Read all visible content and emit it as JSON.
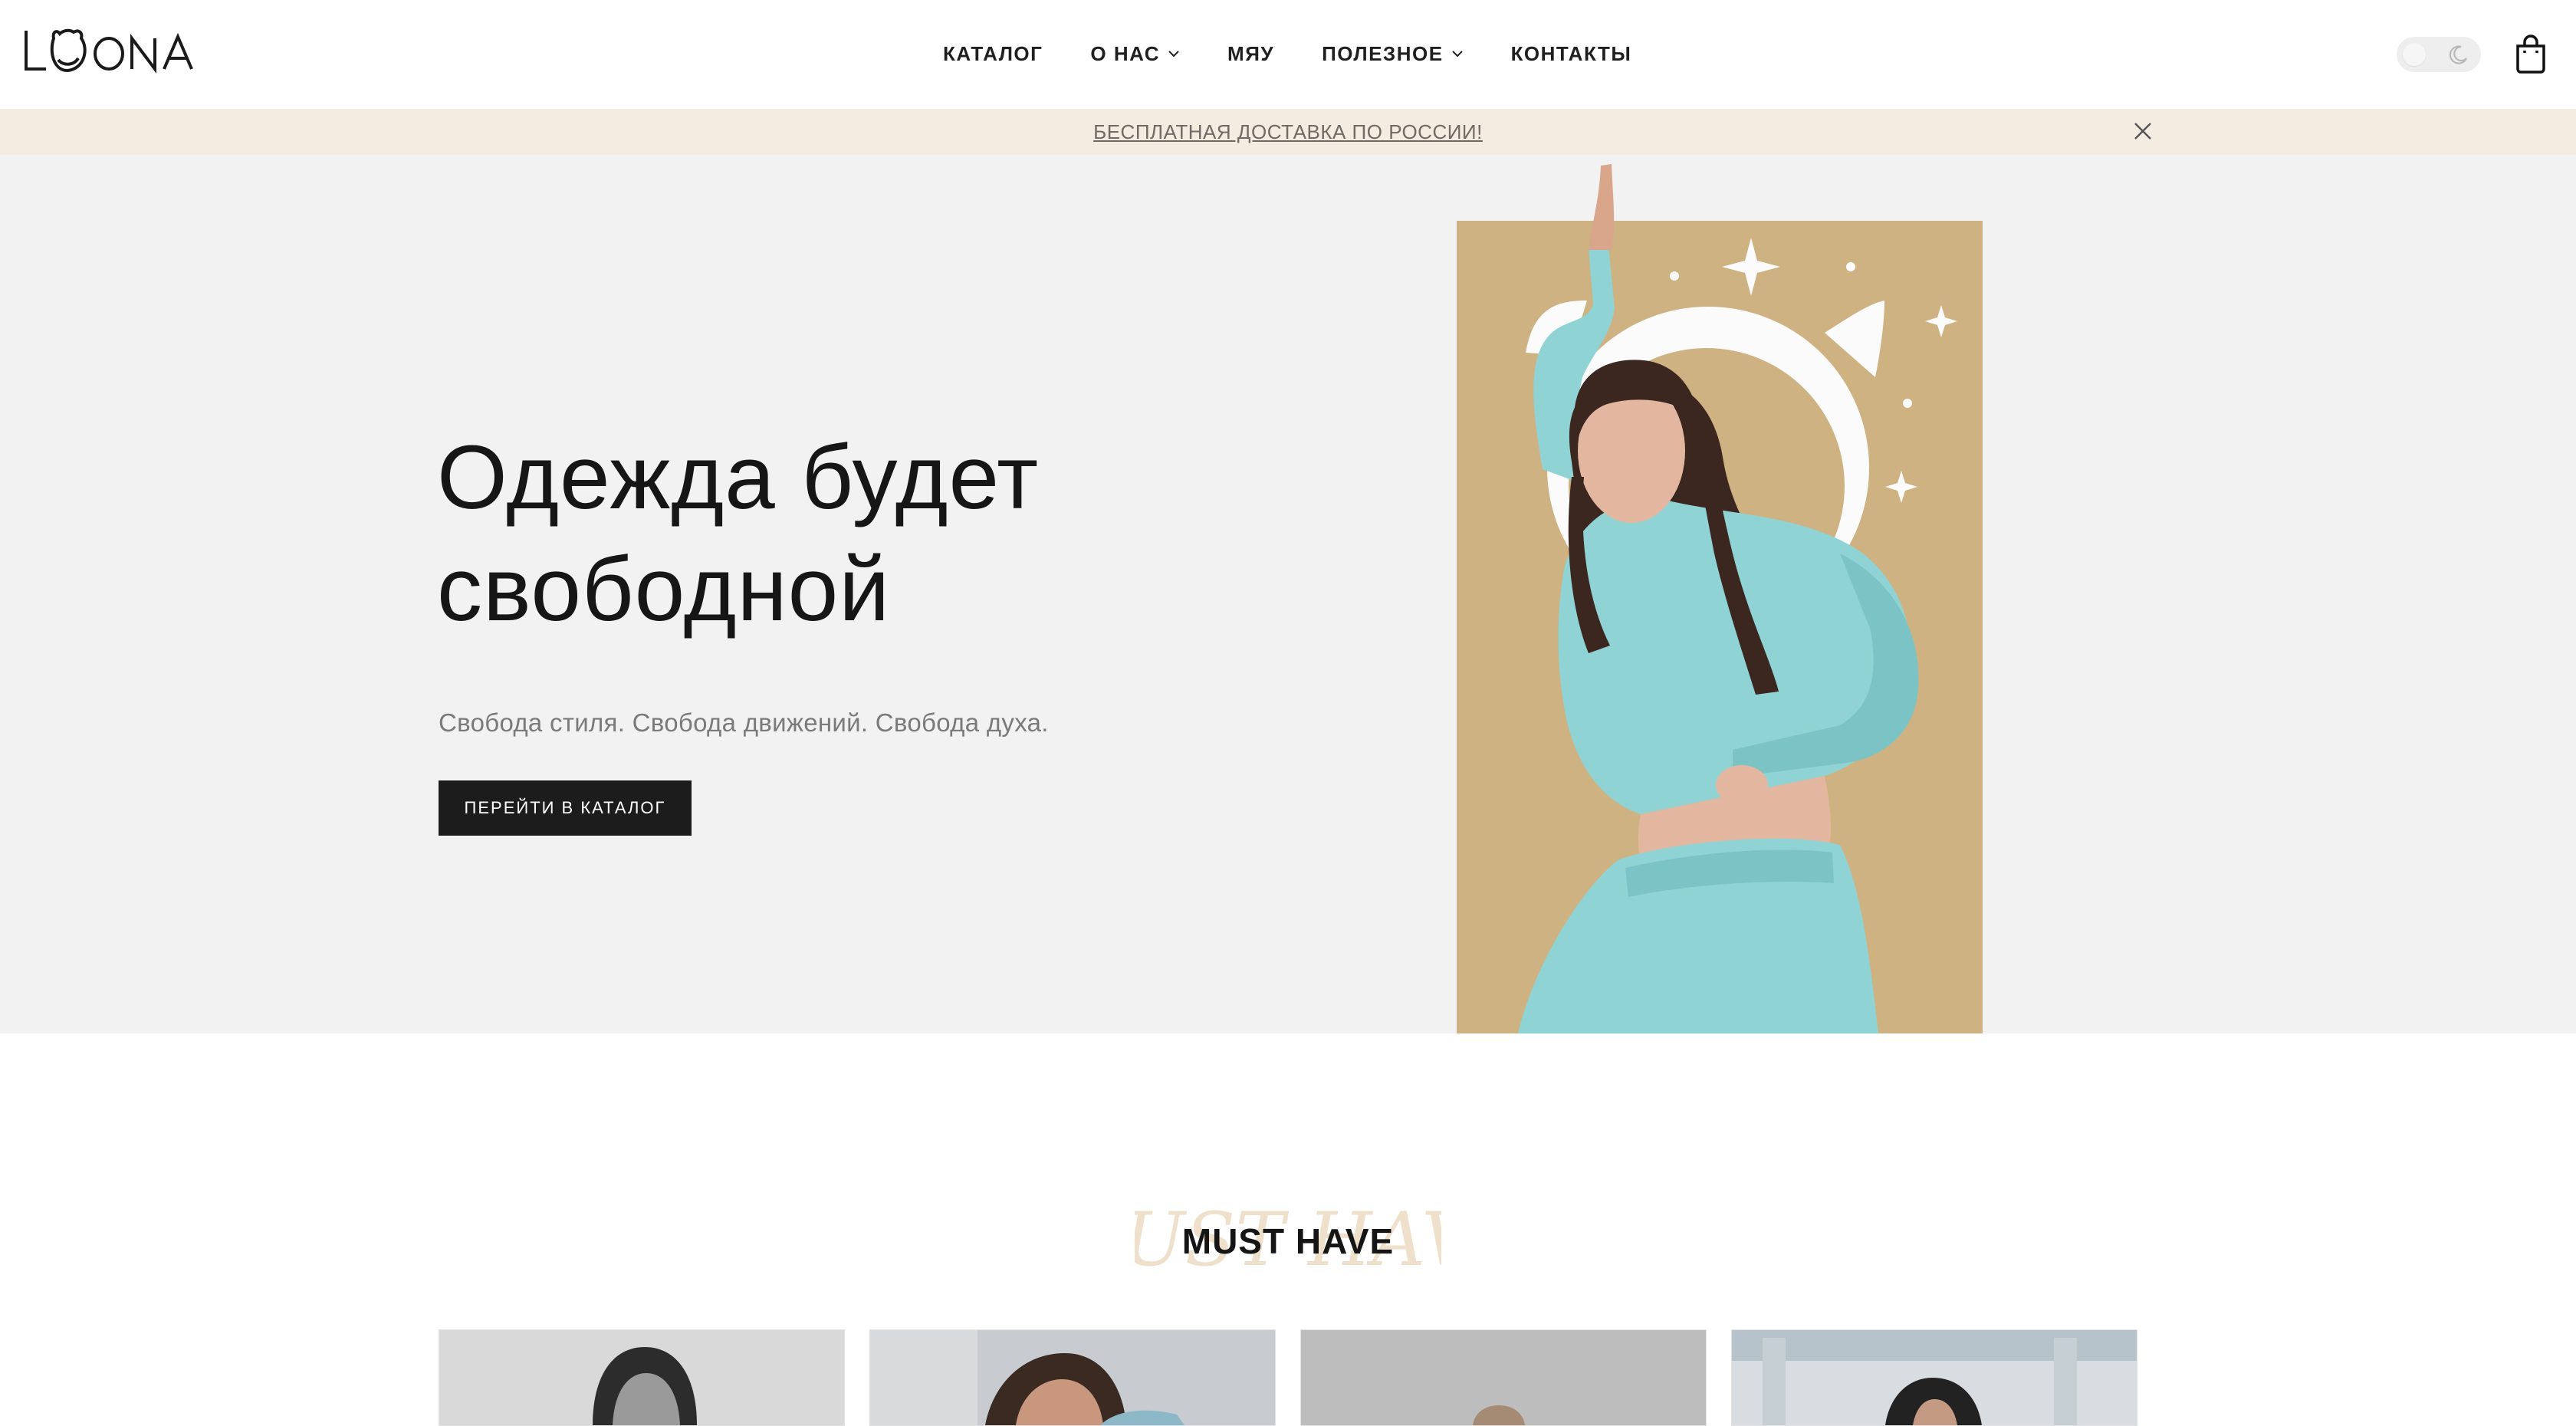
{
  "header": {
    "logo_text": "LOONA",
    "nav": [
      {
        "label": "КАТАЛОГ",
        "has_dropdown": false
      },
      {
        "label": "О НАС",
        "has_dropdown": true
      },
      {
        "label": "МЯУ",
        "has_dropdown": false
      },
      {
        "label": "ПОЛЕЗНОЕ",
        "has_dropdown": true
      },
      {
        "label": "КОНТАКТЫ",
        "has_dropdown": false
      }
    ],
    "icons": {
      "theme": "moon-icon",
      "cart": "shopping-bag-icon",
      "chevron": "chevron-down-icon"
    }
  },
  "promo": {
    "text": "БЕСПЛАТНАЯ ДОСТАВКА ПО РОССИИ!",
    "close_icon": "close-icon"
  },
  "hero": {
    "title_line1": "Одежда будет",
    "title_line2": "свободной",
    "subtitle": "Свобода стиля. Свобода движений. Свобода духа.",
    "button_label": "ПЕРЕЙТИ В КАТАЛОГ",
    "image_desc": "hero-model-photo"
  },
  "must_have": {
    "title": "MUST HAVE",
    "script_text": "MUST HAVE",
    "cards": [
      {
        "image": "product-photo-1"
      },
      {
        "image": "product-photo-2"
      },
      {
        "image": "product-photo-3"
      },
      {
        "image": "product-photo-4"
      }
    ]
  },
  "colors": {
    "promo_bg": "#f5ece1",
    "hero_bg": "#f2f2f2",
    "art_panel": "#cfb282",
    "sweatsuit": "#8fd3d4",
    "button_bg": "#1c1c1c"
  }
}
